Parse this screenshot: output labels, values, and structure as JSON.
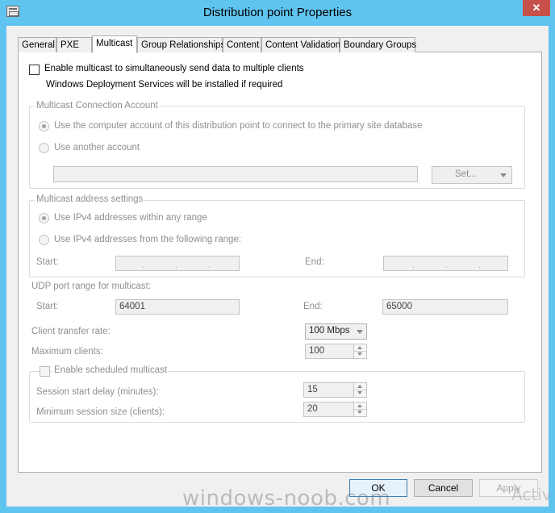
{
  "window": {
    "title": "Distribution point Properties",
    "close_glyph": "✕"
  },
  "tabs": [
    {
      "label": "General"
    },
    {
      "label": "PXE"
    },
    {
      "label": "Multicast"
    },
    {
      "label": "Group Relationships"
    },
    {
      "label": "Content"
    },
    {
      "label": "Content Validation"
    },
    {
      "label": "Boundary Groups"
    }
  ],
  "multicast": {
    "enable_label": "Enable multicast to simultaneously send data to multiple clients",
    "wds_note": "Windows Deployment Services will be installed if required",
    "connection_account": {
      "group_label": "Multicast Connection Account",
      "radio_computer_account": "Use the computer account of this distribution point to connect to the primary site database",
      "radio_another_account": "Use another account",
      "account_value": "",
      "set_button_label": "Set..."
    },
    "address_settings": {
      "group_label": "Multicast address settings",
      "radio_any_range": "Use IPv4 addresses within any range",
      "radio_following_range": "Use IPv4 addresses from the following range:",
      "start_label": "Start:",
      "end_label": "End:",
      "ip_dot": "."
    },
    "udp": {
      "label": "UDP port range for multicast:",
      "start_label": "Start:",
      "start_value": "64001",
      "end_label": "End:",
      "end_value": "65000"
    },
    "client_transfer_rate": {
      "label": "Client transfer rate:",
      "value": "100 Mbps"
    },
    "maximum_clients": {
      "label": "Maximum clients:",
      "value": "100"
    },
    "scheduled": {
      "enable_label": "Enable scheduled multicast",
      "session_start_delay_label": "Session start delay (minutes):",
      "session_start_delay_value": "15",
      "min_session_size_label": "Minimum session size (clients):",
      "min_session_size_value": "20"
    }
  },
  "buttons": {
    "ok": "OK",
    "cancel": "Cancel",
    "apply": "Apply"
  },
  "overlay": {
    "watermark": "windows-noob.com",
    "activate": "Activ"
  }
}
